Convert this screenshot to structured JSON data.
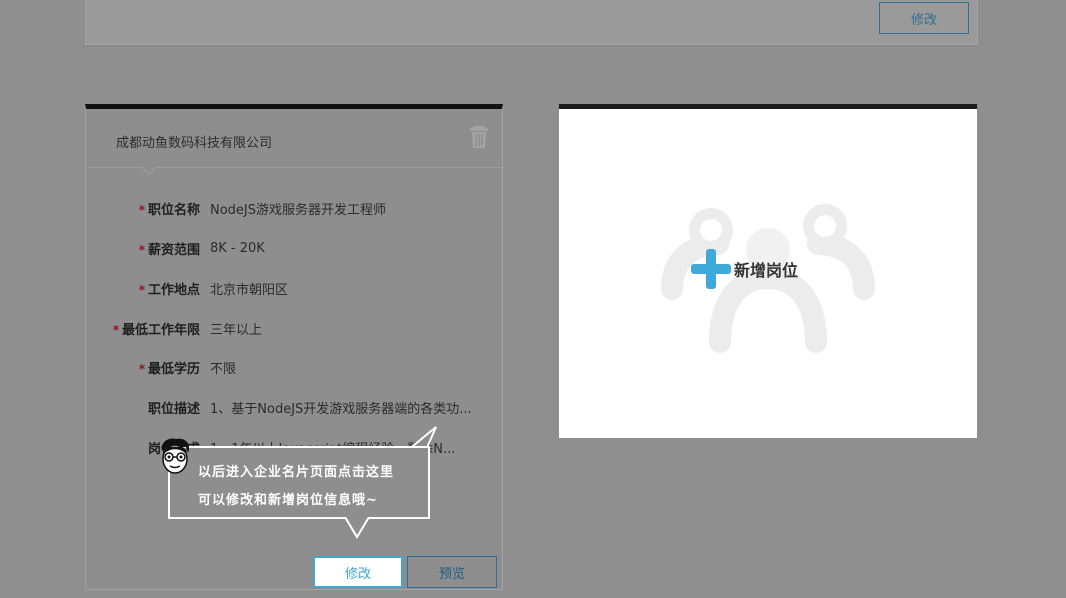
{
  "top_card": {
    "edit_label": "修改"
  },
  "job": {
    "company": "成都动鱼数码科技有限公司",
    "fields": [
      {
        "label": "职位名称",
        "value": "NodeJS游戏服务器开发工程师",
        "required": true
      },
      {
        "label": "薪资范围",
        "value": "8K - 20K",
        "required": true
      },
      {
        "label": "工作地点",
        "value": "北京市朝阳区",
        "required": true
      },
      {
        "label": "最低工作年限",
        "value": "三年以上",
        "required": true
      },
      {
        "label": "最低学历",
        "value": "不限",
        "required": true
      },
      {
        "label": "职位描述",
        "value": "1、基于NodeJS开发游戏服务器端的各类功...",
        "required": false
      },
      {
        "label": "岗位要求",
        "value": "1、1年以上Javascript编程经验，熟悉N...",
        "required": false
      }
    ],
    "required_mark": "*",
    "edit_label": "修改",
    "preview_label": "预览"
  },
  "tip": {
    "line1": "以后进入企业名片页面点击这里",
    "line2": "可以修改和新增岗位信息哦~"
  },
  "add_position": {
    "label": "新增岗位"
  },
  "colors": {
    "accent": "#3fa9d9",
    "required": "#8e1313",
    "overlay": "#8f8f8f"
  }
}
